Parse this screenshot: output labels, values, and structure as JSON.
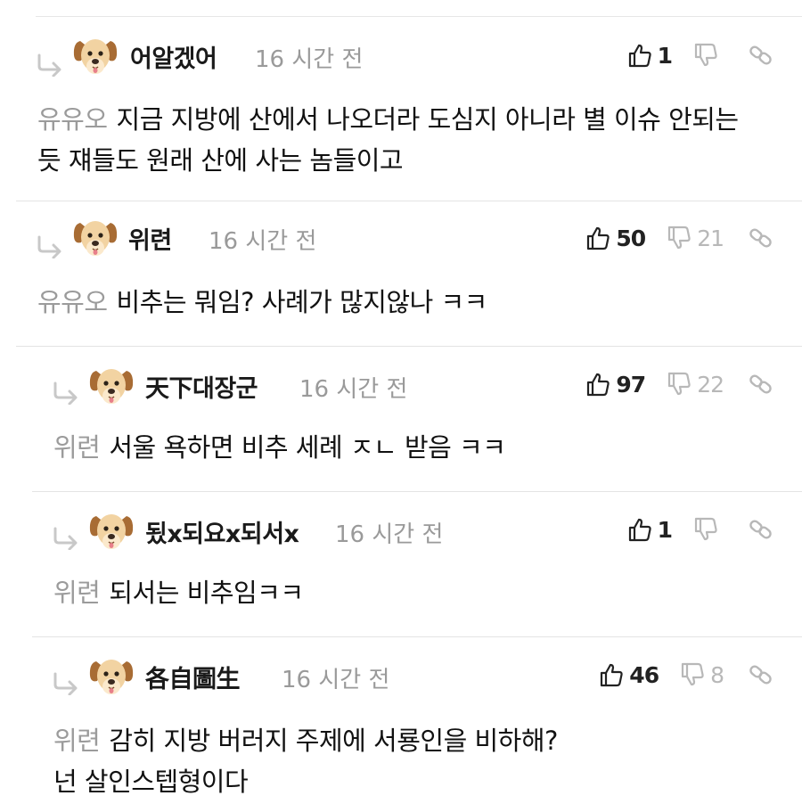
{
  "comments": [
    {
      "author": "어알겠어",
      "time": "16 시간 전",
      "likes": "1",
      "dislikes": "",
      "mention": "유유오",
      "text_lines": [
        "지금 지방에 산에서 나오더라 도심지 아니라 별 이슈 안되는",
        "듯 쟤들도 원래 산에 사는 놈들이고"
      ]
    },
    {
      "author": "위련",
      "time": "16 시간 전",
      "likes": "50",
      "dislikes": "21",
      "mention": "유유오",
      "text_lines": [
        "비추는 뭐임? 사례가 많지않나 ㅋㅋ"
      ]
    },
    {
      "author": "天下대장군",
      "time": "16 시간 전",
      "likes": "97",
      "dislikes": "22",
      "mention": "위련",
      "text_lines": [
        "서울 욕하면 비추 세례 ㅈㄴ 받음 ㅋㅋ"
      ]
    },
    {
      "author": "됬x되요x되서x",
      "time": "16 시간 전",
      "likes": "1",
      "dislikes": "",
      "mention": "위련",
      "text_lines": [
        "되서는 비추임ㅋㅋ"
      ]
    },
    {
      "author": "各自圖生",
      "time": "16 시간 전",
      "likes": "46",
      "dislikes": "8",
      "mention": "위련",
      "text_lines": [
        "감히 지방 버러지 주제에 서룡인을 비하해?",
        "넌 살인스텝형이다"
      ]
    }
  ],
  "icons": {
    "reply": "reply-arrow-icon",
    "avatar": "puppy-avatar-icon",
    "like": "thumbs-up-icon",
    "dislike": "thumbs-down-icon",
    "link": "link-icon"
  },
  "colors": {
    "like_count": "#222222",
    "dislike_count": "#b8b8b8",
    "mention": "#9b9b9b",
    "time": "#9a9a9a",
    "divider": "#e4e4e4"
  }
}
